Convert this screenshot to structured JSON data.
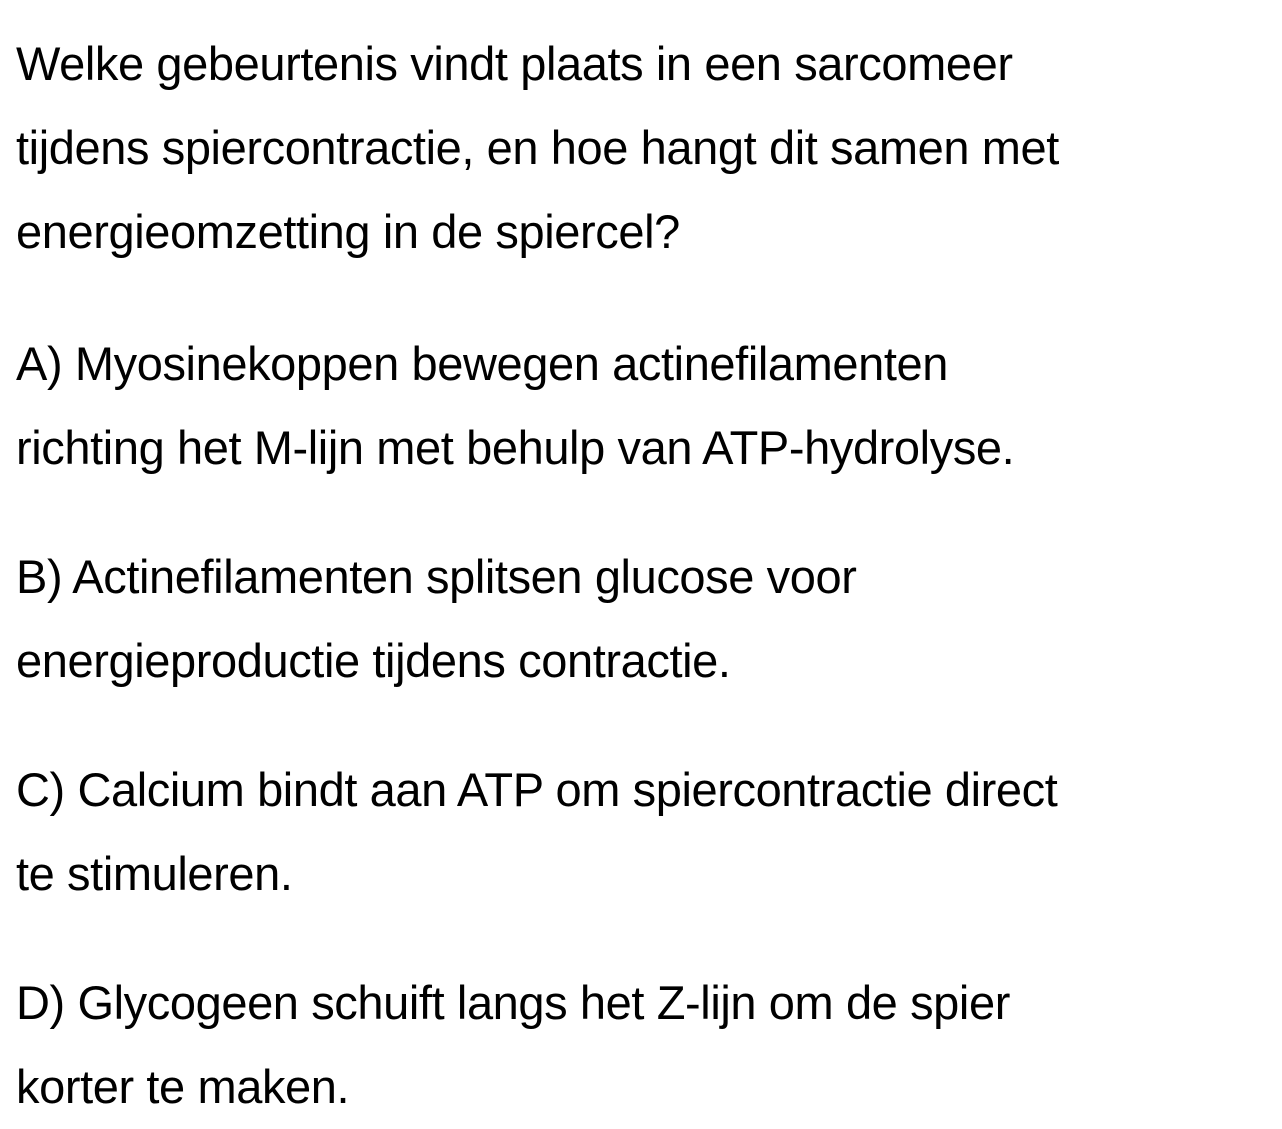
{
  "question": {
    "lines": [
      "Welke gebeurtenis vindt plaats in een sarcomeer",
      "tijdens spiercontractie, en hoe hangt dit samen met",
      "energieomzetting in de spiercel?"
    ]
  },
  "options": [
    {
      "lines": [
        "A) Myosinekoppen bewegen actinefilamenten",
        "richting het M-lijn met behulp van ATP-hydrolyse."
      ]
    },
    {
      "lines": [
        "B) Actinefilamenten splitsen glucose voor",
        "energieproductie tijdens contractie."
      ]
    },
    {
      "lines": [
        "C) Calcium bindt aan ATP om spiercontractie direct",
        "te stimuleren."
      ]
    },
    {
      "lines": [
        "D) Glycogeen schuift langs het Z-lijn om de spier",
        "korter te maken."
      ]
    }
  ]
}
